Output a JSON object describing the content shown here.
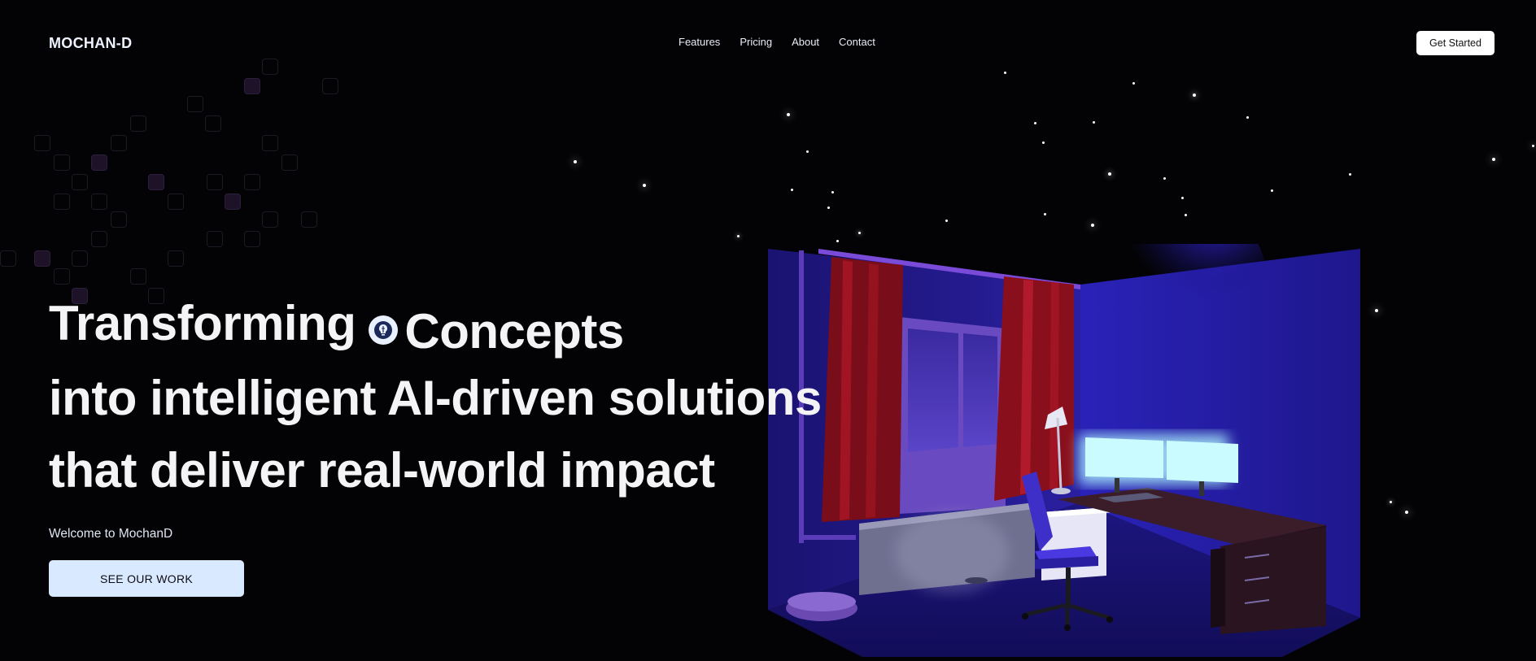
{
  "header": {
    "logo": "MOCHAN-D",
    "nav": [
      {
        "label": "Features"
      },
      {
        "label": "Pricing"
      },
      {
        "label": "About"
      },
      {
        "label": "Contact"
      }
    ],
    "cta_label": "Get Started"
  },
  "hero": {
    "line1_word1": "Transforming",
    "line1_word2": "Concepts",
    "line2": "into intelligent AI-driven solutions",
    "line3": "that deliver real-world impact",
    "welcome": "Welcome to MochanD",
    "button_label": "SEE OUR WORK",
    "icon": "lightbulb-brain-icon"
  },
  "colors": {
    "background": "#030306",
    "button_bg": "#d9e9ff",
    "room_purple": "#2a1a9a",
    "monitor_glow": "#bff9ff",
    "curtain_red": "#8a0f1c"
  }
}
